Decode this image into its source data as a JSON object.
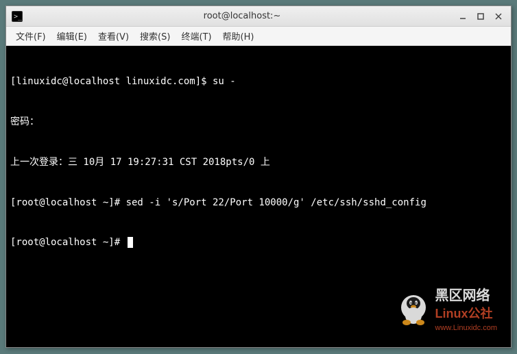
{
  "titlebar": {
    "title": "root@localhost:~"
  },
  "menubar": {
    "file": "文件(F)",
    "edit": "编辑(E)",
    "view": "查看(V)",
    "search": "搜索(S)",
    "terminal": "终端(T)",
    "help": "帮助(H)"
  },
  "terminal": {
    "line1": "[linuxidc@localhost linuxidc.com]$ su -",
    "line2": "密码：",
    "line3": "上一次登录：三 10月 17 19:27:31 CST 2018pts/0 上",
    "line4": "[root@localhost ~]# sed -i 's/Port 22/Port 10000/g' /etc/ssh/sshd_config",
    "line5": "[root@localhost ~]# "
  },
  "watermark": {
    "line1": "黑区网络",
    "line2": "Linux公社",
    "line3": "www.Linuxidc.com"
  }
}
